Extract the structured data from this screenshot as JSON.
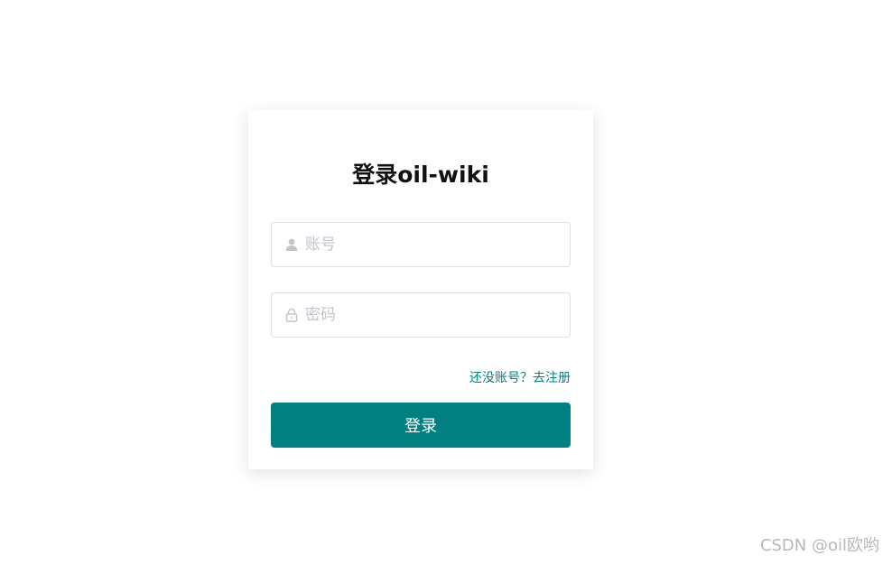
{
  "login": {
    "title": "登录oil-wiki",
    "username_placeholder": "账号",
    "password_placeholder": "密码",
    "register_link": "还没账号？去注册",
    "submit_label": "登录"
  },
  "icons": {
    "username": "user-icon",
    "password": "lock-icon"
  },
  "colors": {
    "accent": "#008080",
    "input_border": "#dcdfe6",
    "placeholder": "#c0c4cc"
  },
  "watermark": "CSDN @oil欧哟"
}
